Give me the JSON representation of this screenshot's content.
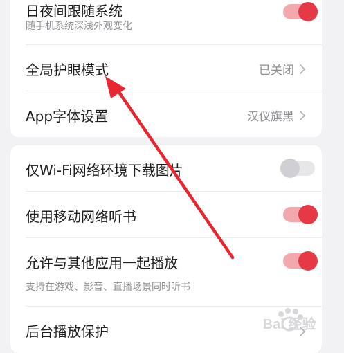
{
  "settings_group_1": {
    "day_night": {
      "title": "日夜间跟随系统",
      "subtitle": "随手机系统深浅外观变化",
      "toggle_on": true
    },
    "eye_protection": {
      "title": "全局护眼模式",
      "value": "已关闭"
    },
    "app_font": {
      "title": "App字体设置",
      "value": "汉仪旗黑"
    }
  },
  "settings_group_2": {
    "wifi_images": {
      "title": "仅Wi-Fi网络环境下载图片",
      "toggle_on": false
    },
    "mobile_listen": {
      "title": "使用移动网络听书",
      "toggle_on": true
    },
    "allow_mix": {
      "title": "允许与其他应用一起播放",
      "subtitle": "支持在游戏、影音、直播场景同时听书",
      "toggle_on": true
    },
    "background_play": {
      "title": "后台播放保护"
    }
  },
  "colors": {
    "accent": "#e63946",
    "accent_track": "#f2a8ac",
    "annotation_arrow": "#e8262f"
  },
  "icons": [
    "chevron-right-icon",
    "red-annotation-arrow",
    "baidu-logo-watermark"
  ],
  "watermark": {
    "text": "Bai 经验"
  }
}
